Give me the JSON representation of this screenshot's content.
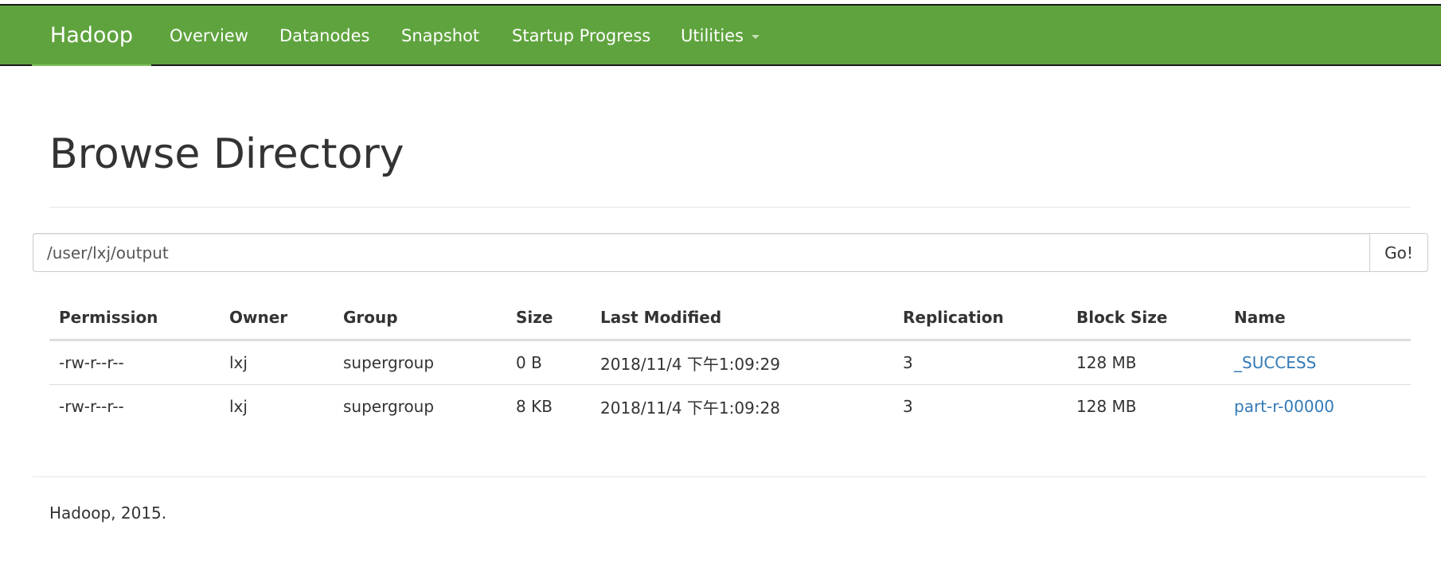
{
  "navbar": {
    "brand": "Hadoop",
    "items": [
      {
        "label": "Overview"
      },
      {
        "label": "Datanodes"
      },
      {
        "label": "Snapshot"
      },
      {
        "label": "Startup Progress"
      },
      {
        "label": "Utilities",
        "has_dropdown": true
      }
    ],
    "background_color": "#5fa33e"
  },
  "page": {
    "title": "Browse Directory"
  },
  "path_bar": {
    "value": "/user/lxj/output",
    "go_label": "Go!"
  },
  "table": {
    "headers": [
      "Permission",
      "Owner",
      "Group",
      "Size",
      "Last Modified",
      "Replication",
      "Block Size",
      "Name"
    ],
    "rows": [
      {
        "permission": "-rw-r--r--",
        "owner": "lxj",
        "group": "supergroup",
        "size": "0 B",
        "last_modified": "2018/11/4 下午1:09:29",
        "replication": "3",
        "block_size": "128 MB",
        "name": "_SUCCESS"
      },
      {
        "permission": "-rw-r--r--",
        "owner": "lxj",
        "group": "supergroup",
        "size": "8 KB",
        "last_modified": "2018/11/4 下午1:09:28",
        "replication": "3",
        "block_size": "128 MB",
        "name": "part-r-00000"
      }
    ],
    "link_color": "#337ab7"
  },
  "footer": {
    "text": "Hadoop, 2015."
  }
}
